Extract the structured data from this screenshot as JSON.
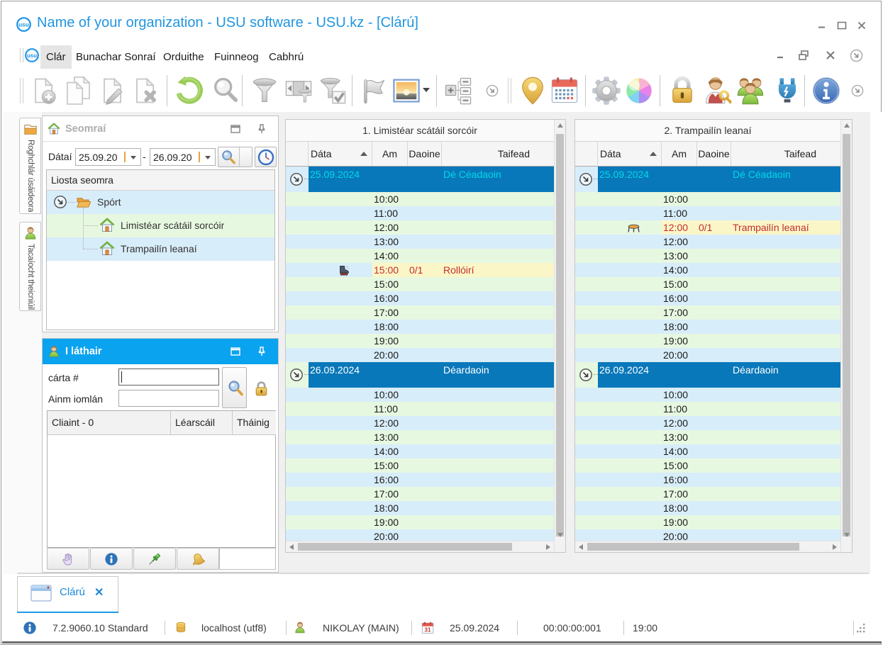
{
  "window": {
    "title": "Name of your organization - USU software - USU.kz - [Clárú]"
  },
  "menu": {
    "items": [
      "Clár",
      "Bunachar Sonraí",
      "Orduithe",
      "Fuinneog",
      "Cabhrú"
    ],
    "active_item": "Clár"
  },
  "toolbar": {
    "icons": [
      "new-record",
      "copy-record",
      "edit-record",
      "delete-record",
      "refresh",
      "search",
      "filter",
      "filter-columns",
      "filter-check",
      "flag",
      "picture",
      "detail-list",
      "more-options",
      "map-pin",
      "calendar",
      "settings-gear",
      "color-wheel",
      "lock",
      "user-key",
      "user-group",
      "plugin",
      "info",
      "more-options"
    ]
  },
  "sidebar": {
    "tabs": [
      {
        "label": "Roghchlár úsáideora",
        "icon": "folder"
      },
      {
        "label": "Tacaíocht theicniúil",
        "icon": "person"
      }
    ]
  },
  "rooms_panel": {
    "title": "Seomraí",
    "date_label": "Dátaí",
    "date_from": "25.09.20",
    "date_to": "26.09.20",
    "date_separator": "-",
    "tree_header": "Liosta seomra",
    "tree": [
      {
        "label": "Spórt",
        "type": "folder",
        "row_color": "blue"
      },
      {
        "label": "Limistéar scátáil sorcóir",
        "type": "room",
        "row_color": "green"
      },
      {
        "label": "Trampailín leanaí",
        "type": "room",
        "row_color": "blue"
      }
    ]
  },
  "present_panel": {
    "title": "I láthair",
    "card_label": "cárta #",
    "name_label": "Ainm iomlán",
    "card_value": "",
    "name_value": "",
    "table_headers": [
      "Cliaint - 0",
      "Léarscáil",
      "Tháinig"
    ],
    "buttons": [
      "hand",
      "info",
      "pin",
      "bell"
    ]
  },
  "schedules": [
    {
      "title": "1. Limistéar scátáil sorcóir",
      "columns": [
        "Dáta",
        "Am",
        "Daoine",
        "Taifead"
      ],
      "groups": [
        {
          "date": "25.09.2024",
          "day": "Dé Céadaoin",
          "selected": true,
          "rows": [
            {
              "time": "10:00"
            },
            {
              "time": "11:00"
            },
            {
              "time": "12:00"
            },
            {
              "time": "13:00"
            },
            {
              "time": "14:00"
            },
            {
              "time": "15:00",
              "people": "0/1",
              "label": "Rollóirí",
              "icon": "roller-skate",
              "booked": true
            },
            {
              "time": "15:00"
            },
            {
              "time": "16:00"
            },
            {
              "time": "17:00"
            },
            {
              "time": "18:00"
            },
            {
              "time": "19:00"
            },
            {
              "time": "20:00"
            }
          ]
        },
        {
          "date": "26.09.2024",
          "day": "Déardaoin",
          "selected": false,
          "rows": [
            {
              "time": "10:00"
            },
            {
              "time": "11:00"
            },
            {
              "time": "12:00"
            },
            {
              "time": "13:00"
            },
            {
              "time": "14:00"
            },
            {
              "time": "15:00"
            },
            {
              "time": "16:00"
            },
            {
              "time": "17:00"
            },
            {
              "time": "18:00"
            },
            {
              "time": "19:00"
            },
            {
              "time": "20:00"
            }
          ]
        }
      ]
    },
    {
      "title": "2. Trampailín leanaí",
      "columns": [
        "Dáta",
        "Am",
        "Daoine",
        "Taifead"
      ],
      "groups": [
        {
          "date": "25.09.2024",
          "day": "Dé Céadaoin",
          "selected": true,
          "rows": [
            {
              "time": "10:00"
            },
            {
              "time": "11:00"
            },
            {
              "time": "12:00",
              "people": "0/1",
              "label": "Trampailín leanaí",
              "icon": "trampoline",
              "booked": true
            },
            {
              "time": "12:00"
            },
            {
              "time": "13:00"
            },
            {
              "time": "14:00"
            },
            {
              "time": "15:00"
            },
            {
              "time": "16:00"
            },
            {
              "time": "17:00"
            },
            {
              "time": "18:00"
            },
            {
              "time": "19:00"
            },
            {
              "time": "20:00"
            }
          ]
        },
        {
          "date": "26.09.2024",
          "day": "Déardaoin",
          "selected": false,
          "rows": [
            {
              "time": "10:00"
            },
            {
              "time": "11:00"
            },
            {
              "time": "12:00"
            },
            {
              "time": "13:00"
            },
            {
              "time": "14:00"
            },
            {
              "time": "15:00"
            },
            {
              "time": "16:00"
            },
            {
              "time": "17:00"
            },
            {
              "time": "18:00"
            },
            {
              "time": "19:00"
            },
            {
              "time": "20:00"
            }
          ]
        }
      ]
    }
  ],
  "bottom_tab": {
    "label": "Clárú",
    "close": "✕"
  },
  "status_bar": {
    "version": "7.2.9060.10 Standard",
    "host": "localhost (utf8)",
    "user": "NIKOLAY (MAIN)",
    "date": "25.09.2024",
    "timer": "00:00:00:001",
    "time": "19:00"
  },
  "colors": {
    "accent_blue": "#0aa3ef",
    "group_blue": "#0878ba",
    "row_green": "#e7f8e1",
    "row_blue": "#d8edfa",
    "row_booked": "#fbf6c8",
    "booked_text": "#c22e2e",
    "selected_group_text": "#00d9e8",
    "title_blue": "#2196e0"
  }
}
